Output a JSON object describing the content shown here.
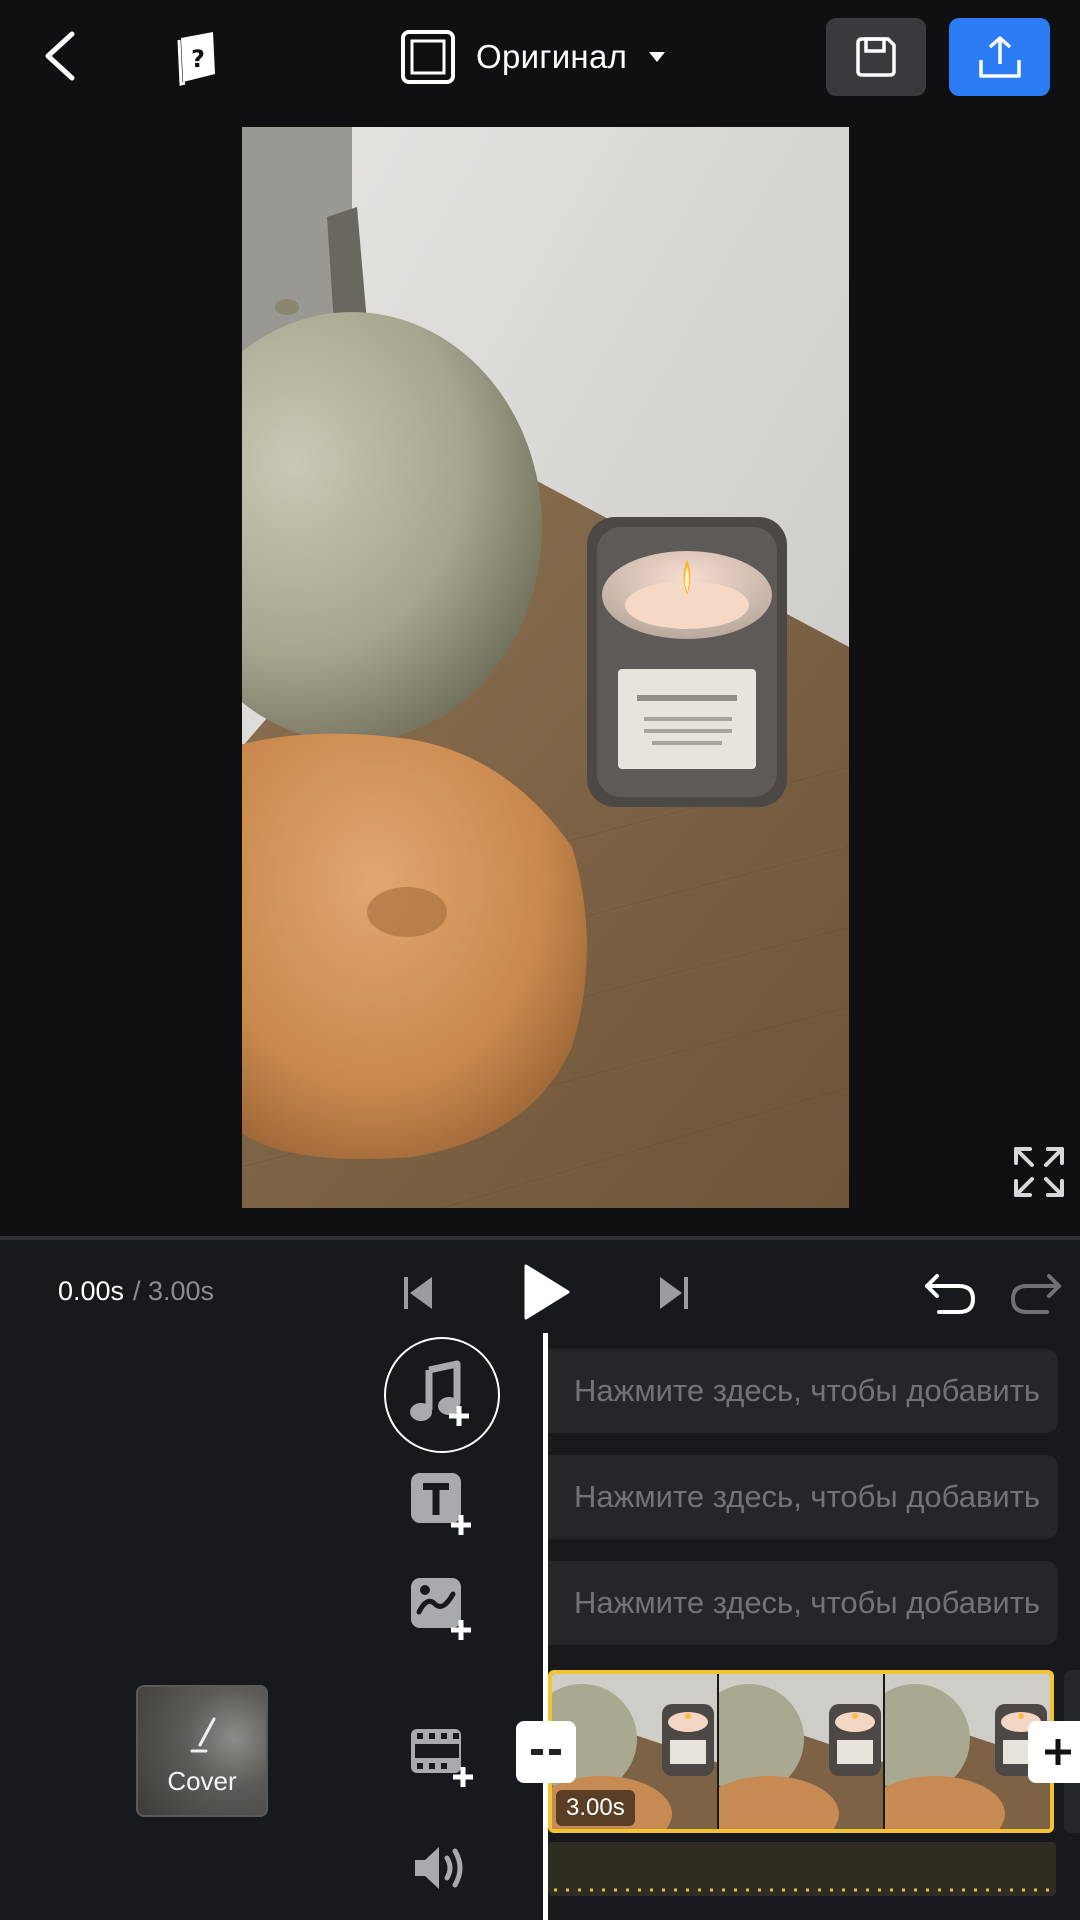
{
  "topbar": {
    "aspect_ratio_label": "Оригинал",
    "export_color": "#2b7cf5"
  },
  "playback": {
    "current_time": "0.00s",
    "total_time": "/ 3.00s"
  },
  "tracks": {
    "audio_placeholder": "Нажмите здесь, чтобы добавить",
    "text_placeholder": "Нажмите здесь, чтобы добавить",
    "sticker_placeholder": "Нажмите здесь, чтобы добавить"
  },
  "cover": {
    "label": "Cover"
  },
  "timeline": {
    "clip_duration": "3.00s",
    "selection_color": "#f2c431"
  },
  "icons": {
    "back": "chevron-left-icon",
    "help": "help-book-icon",
    "ratio": "aspect-ratio-icon",
    "save": "save-floppy-icon",
    "export": "upload-icon",
    "fullscreen": "expand-icon",
    "skip_back": "skip-start-icon",
    "play": "play-icon",
    "skip_forward": "skip-end-icon",
    "undo": "undo-icon",
    "redo": "redo-icon",
    "add_music": "add-music-icon",
    "add_text": "add-text-icon",
    "add_sticker": "add-sticker-icon",
    "add_media": "add-media-icon",
    "volume": "volume-icon"
  }
}
